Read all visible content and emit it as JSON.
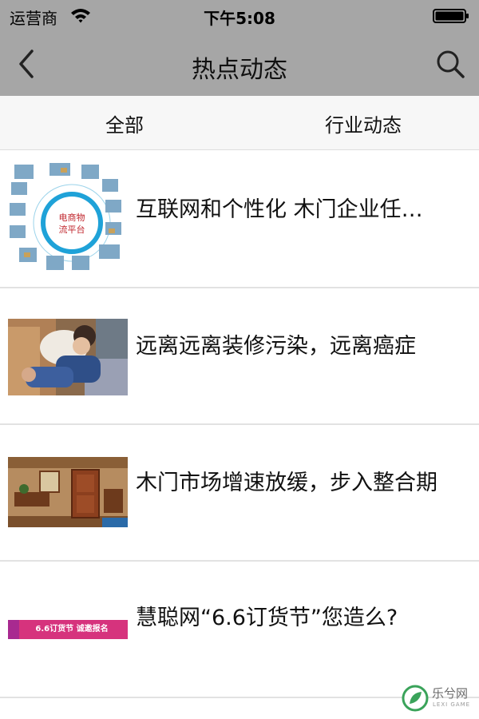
{
  "status_bar": {
    "carrier": "运营商",
    "time": "下午5:08"
  },
  "nav": {
    "title": "热点动态"
  },
  "tabs": [
    {
      "label": "全部"
    },
    {
      "label": "行业动态"
    }
  ],
  "articles": [
    {
      "title": "互联网和个性化 木门企业任…",
      "thumb": {
        "center_label": "电商物流平台"
      }
    },
    {
      "title": "远离远离装修污染，远离癌症"
    },
    {
      "title": "木门市场增速放缓，步入整合期"
    },
    {
      "title": "慧聪网“6.6订货节”您造么?",
      "thumb": {
        "banner_text": "6.6订货节  诚邀报名"
      }
    }
  ],
  "watermark": {
    "name": "乐兮网",
    "sub": "LEXI GAME"
  },
  "colors": {
    "header_bg": "#a6a6a6",
    "tab_bg": "#f7f7f7",
    "divider": "#e2e2e2",
    "banner": "#d6337d"
  }
}
